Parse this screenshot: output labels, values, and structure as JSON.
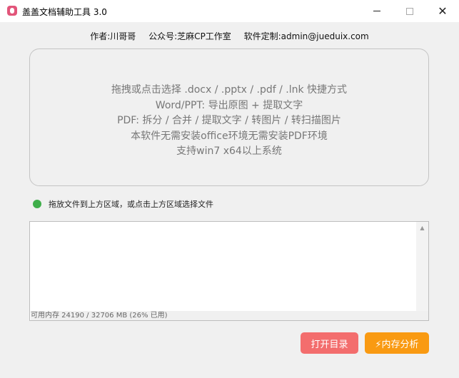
{
  "window": {
    "title": "盖盖文档辅助工具 3.0",
    "min_glyph": "",
    "max_glyph": "",
    "close_glyph": "✕"
  },
  "info": {
    "author": "作者:川哥哥",
    "official_account": "公众号:芝麻CP工作室",
    "custom": "软件定制:admin@jueduix.com"
  },
  "drop_zone": {
    "lines": [
      "拖拽或点击选择 .docx / .pptx / .pdf / .lnk 快捷方式",
      "Word/PPT: 导出原图 + 提取文字",
      "PDF: 拆分 / 合并 / 提取文字 / 转图片 / 转扫描图片",
      "本软件无需安装office环境无需安装PDF环境",
      "支持win7 x64以上系统"
    ]
  },
  "status": {
    "text": "拖放文件到上方区域，或点击上方区域选择文件",
    "color": "#3fae4a"
  },
  "log": {
    "content": "",
    "memory_text": "可用内存 24190 / 32706 MB (26% 已用)",
    "scroll_up_glyph": "▲"
  },
  "buttons": {
    "open_dir": "打开目录",
    "memory_analysis": "⚡内存分析"
  },
  "colors": {
    "open_button": "#f36d6d",
    "memory_button": "#f99a12",
    "app_icon": "#e2557a"
  }
}
